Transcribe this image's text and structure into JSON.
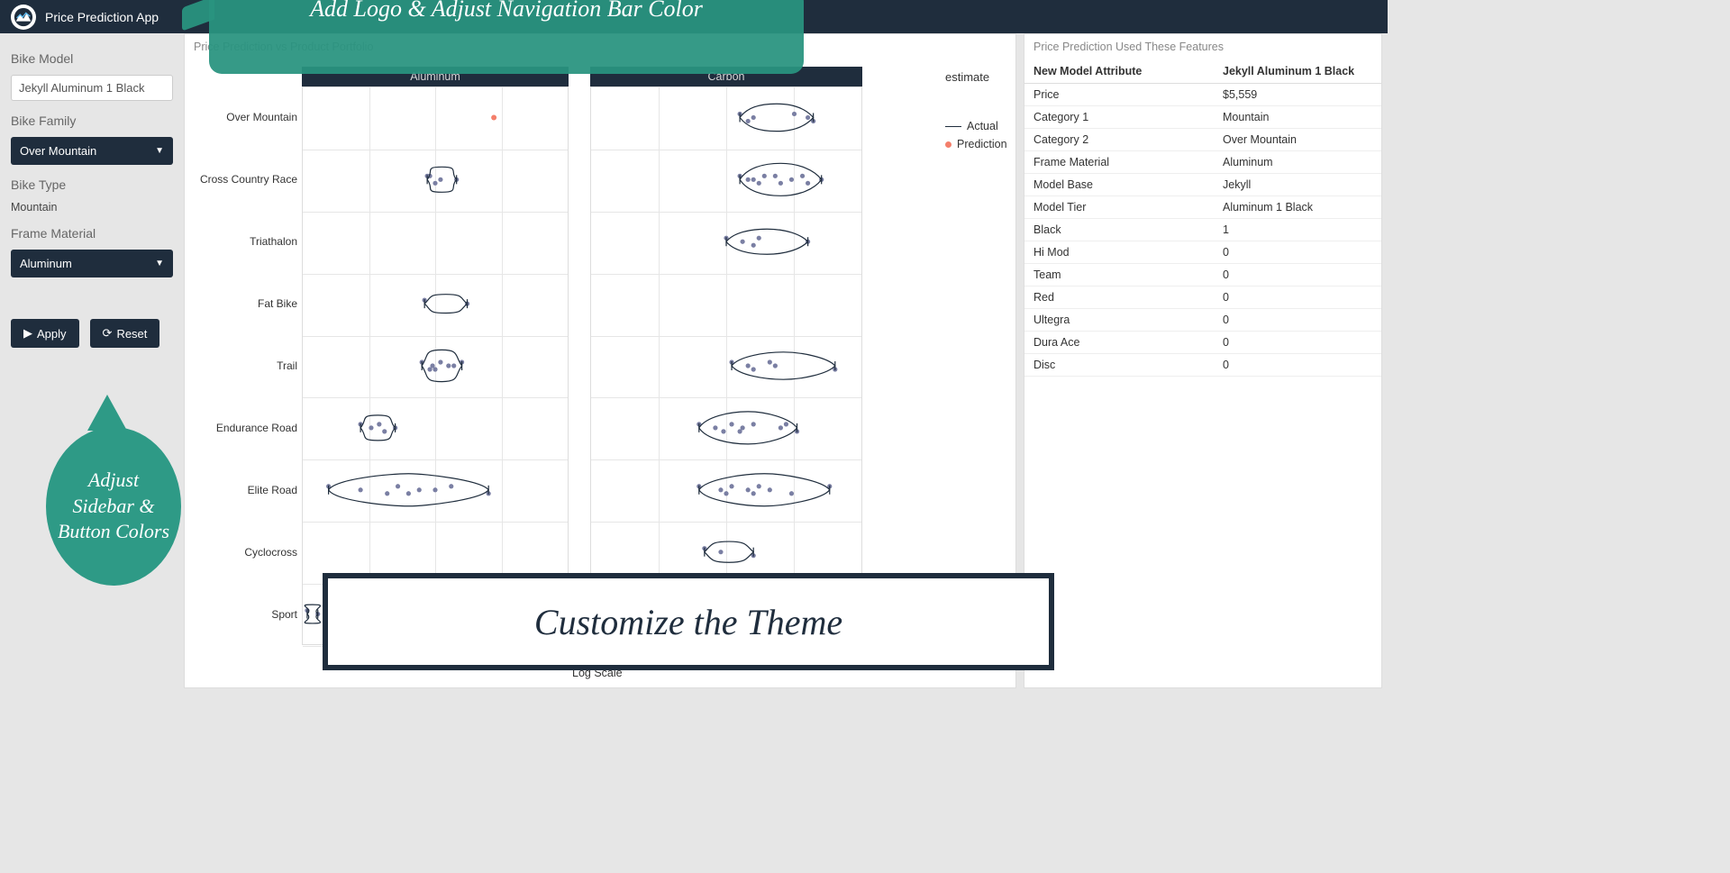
{
  "navbar": {
    "title": "Price Prediction App"
  },
  "sidebar": {
    "model_label": "Bike Model",
    "model_value": "Jekyll Aluminum 1 Black",
    "family_label": "Bike Family",
    "family_value": "Over Mountain",
    "type_label": "Bike Type",
    "type_value": "Mountain",
    "material_label": "Frame Material",
    "material_value": "Aluminum",
    "apply": "Apply",
    "reset": "Reset"
  },
  "chart": {
    "title": "Price Prediction vs Product Portfolio",
    "facet_a": "Aluminum",
    "facet_c": "Carbon",
    "legend_title": "estimate",
    "legend_actual": "Actual",
    "legend_pred": "Prediction",
    "xlabel": "Log Scale",
    "yticks": [
      "Over Mountain",
      "Cross Country Race",
      "Triathalon",
      "Fat Bike",
      "Trail",
      "Endurance Road",
      "Elite Road",
      "Cyclocross",
      "Sport"
    ]
  },
  "features": {
    "title": "Price Prediction Used These Features",
    "head_a": "New Model Attribute",
    "head_b": "Jekyll Aluminum 1 Black",
    "rows": [
      [
        "Price",
        "$5,559"
      ],
      [
        "Category 1",
        "Mountain"
      ],
      [
        "Category 2",
        "Over Mountain"
      ],
      [
        "Frame Material",
        "Aluminum"
      ],
      [
        "Model Base",
        "Jekyll"
      ],
      [
        "Model Tier",
        "Aluminum 1 Black"
      ],
      [
        "Black",
        "1"
      ],
      [
        "Hi Mod",
        "0"
      ],
      [
        "Team",
        "0"
      ],
      [
        "Red",
        "0"
      ],
      [
        "Ultegra",
        "0"
      ],
      [
        "Dura Ace",
        "0"
      ],
      [
        "Disc",
        "0"
      ]
    ]
  },
  "callouts": {
    "top": "Add Logo & Adjust Navigation Bar Color",
    "side": "Adjust Sidebar & Button Colors",
    "banner": "Customize the Theme"
  },
  "chart_data": {
    "type": "scatter",
    "note": "Faceted violin/jitter plot of log-price by bike category, split by frame material. x values are estimated positions on a log-price scale (0–1 within each facet).",
    "facets": [
      "Aluminum",
      "Carbon"
    ],
    "categories": [
      "Over Mountain",
      "Cross Country Race",
      "Triathalon",
      "Fat Bike",
      "Trail",
      "Endurance Road",
      "Elite Road",
      "Cyclocross",
      "Sport"
    ],
    "prediction": {
      "facet": "Aluminum",
      "category": "Over Mountain",
      "x": 0.72
    },
    "series": [
      {
        "facet": "Aluminum",
        "category": "Cross Country Race",
        "x": [
          0.48,
          0.52,
          0.5,
          0.47,
          0.58
        ]
      },
      {
        "facet": "Aluminum",
        "category": "Fat Bike",
        "x": [
          0.46,
          0.62
        ]
      },
      {
        "facet": "Aluminum",
        "category": "Trail",
        "x": [
          0.45,
          0.49,
          0.5,
          0.52,
          0.57,
          0.48,
          0.6,
          0.55
        ]
      },
      {
        "facet": "Aluminum",
        "category": "Endurance Road",
        "x": [
          0.22,
          0.26,
          0.31,
          0.29,
          0.35
        ]
      },
      {
        "facet": "Aluminum",
        "category": "Elite Road",
        "x": [
          0.1,
          0.22,
          0.32,
          0.36,
          0.44,
          0.4,
          0.56,
          0.5,
          0.7
        ]
      },
      {
        "facet": "Aluminum",
        "category": "Sport",
        "x": [
          0.02,
          0.06
        ]
      },
      {
        "facet": "Carbon",
        "category": "Over Mountain",
        "x": [
          0.55,
          0.6,
          0.58,
          0.75,
          0.8,
          0.82
        ]
      },
      {
        "facet": "Carbon",
        "category": "Cross Country Race",
        "x": [
          0.55,
          0.6,
          0.62,
          0.64,
          0.58,
          0.7,
          0.68,
          0.74,
          0.8,
          0.78,
          0.85
        ]
      },
      {
        "facet": "Carbon",
        "category": "Triathalon",
        "x": [
          0.5,
          0.56,
          0.6,
          0.62,
          0.8
        ]
      },
      {
        "facet": "Carbon",
        "category": "Trail",
        "x": [
          0.52,
          0.58,
          0.6,
          0.66,
          0.68,
          0.9
        ]
      },
      {
        "facet": "Carbon",
        "category": "Endurance Road",
        "x": [
          0.4,
          0.46,
          0.49,
          0.52,
          0.56,
          0.55,
          0.6,
          0.7,
          0.76,
          0.72
        ]
      },
      {
        "facet": "Carbon",
        "category": "Elite Road",
        "x": [
          0.4,
          0.48,
          0.5,
          0.52,
          0.58,
          0.6,
          0.62,
          0.66,
          0.74,
          0.88
        ]
      },
      {
        "facet": "Carbon",
        "category": "Cyclocross",
        "x": [
          0.42,
          0.48,
          0.6
        ]
      }
    ]
  }
}
